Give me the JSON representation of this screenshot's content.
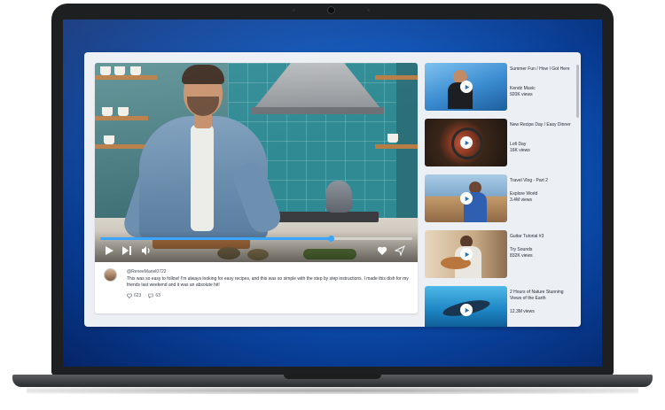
{
  "video": {
    "progress_fraction": 0.74
  },
  "comment": {
    "username": "@ReneeMariel0722",
    "text": "This was so easy to follow! I'm always looking for easy recipes, and this was so simple with the step by step instructions. I made this dish for my friends last weekend and it was an absolute hit!",
    "likes": "623",
    "replies": "63"
  },
  "recommendations": [
    {
      "title": "Summer Fun / How I Got Here",
      "channel": "Kendz Music",
      "views": "920K views",
      "thumb_colors": [
        "#5aa7e6",
        "#1f6fb8"
      ]
    },
    {
      "title": "New Recipe Day / Easy Dinner",
      "channel": "Lofi Day",
      "views": "16K views",
      "thumb_colors": [
        "#6b4a35",
        "#2a1d16"
      ]
    },
    {
      "title": "Travel Vlog - Part 2",
      "channel": "Explore World",
      "views": "3.4M views",
      "thumb_colors": [
        "#8fb6d8",
        "#3d6e98"
      ]
    },
    {
      "title": "Guitar Tutorial #3",
      "channel": "Try Sounds",
      "views": "832K views",
      "thumb_colors": [
        "#d9c4a6",
        "#8a6a4d"
      ]
    },
    {
      "title": "2 Hours of Nature Stunning Views of the Earth",
      "channel": "",
      "views": "12.3M views",
      "thumb_colors": [
        "#2f9fd6",
        "#0b4f86"
      ]
    }
  ],
  "colors": {
    "accent": "#3aa5ff",
    "screen_blue": "#0f5cc4"
  }
}
